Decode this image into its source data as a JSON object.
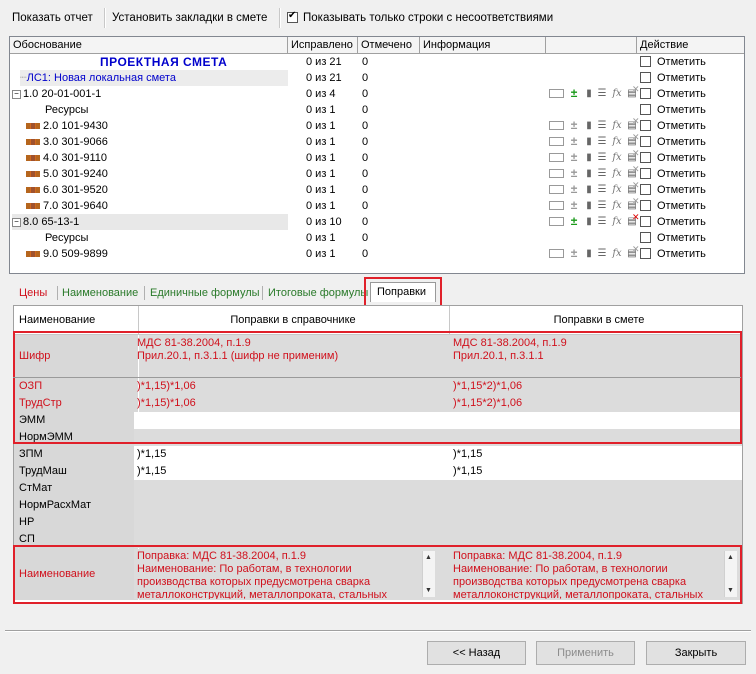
{
  "toolbar": {
    "show_report": "Показать отчет",
    "set_bookmarks": "Установить закладки в смете",
    "only_mismatch_label": "Показывать только строки с несоответствиями",
    "only_mismatch_checked": true
  },
  "tree": {
    "columns": [
      "Обоснование",
      "Исправлено",
      "Отмечено",
      "Информация",
      "",
      "Действие"
    ],
    "rows": [
      {
        "name": "ПРОЕКТНАЯ СМЕТА",
        "fixed": "0 из 21",
        "marked": "0",
        "action": "Отметить",
        "kind": "title"
      },
      {
        "name": "ЛС1: Новая локальная смета",
        "fixed": "0 из 21",
        "marked": "0",
        "action": "Отметить",
        "kind": "ls"
      },
      {
        "name": "1.0   20-01-001-1",
        "fixed": "0 из 4",
        "marked": "0",
        "action": "Отметить",
        "kind": "group",
        "icons": "active"
      },
      {
        "name": "Ресурсы",
        "fixed": "0 из 1",
        "marked": "0",
        "action": "Отметить",
        "kind": "res-label"
      },
      {
        "name": "2.0   101-9430",
        "fixed": "0 из 1",
        "marked": "0",
        "action": "Отметить",
        "kind": "item",
        "icons": "grey"
      },
      {
        "name": "3.0   301-9066",
        "fixed": "0 из 1",
        "marked": "0",
        "action": "Отметить",
        "kind": "item",
        "icons": "grey"
      },
      {
        "name": "4.0   301-9110",
        "fixed": "0 из 1",
        "marked": "0",
        "action": "Отметить",
        "kind": "item",
        "icons": "grey"
      },
      {
        "name": "5.0   301-9240",
        "fixed": "0 из 1",
        "marked": "0",
        "action": "Отметить",
        "kind": "item",
        "icons": "grey"
      },
      {
        "name": "6.0   301-9520",
        "fixed": "0 из 1",
        "marked": "0",
        "action": "Отметить",
        "kind": "item",
        "icons": "grey"
      },
      {
        "name": "7.0   301-9640",
        "fixed": "0 из 1",
        "marked": "0",
        "action": "Отметить",
        "kind": "item",
        "icons": "grey"
      },
      {
        "name": "8.0   65-13-1",
        "fixed": "0 из 10",
        "marked": "0",
        "action": "Отметить",
        "kind": "group",
        "icons": "active-red"
      },
      {
        "name": "Ресурсы",
        "fixed": "0 из 1",
        "marked": "0",
        "action": "Отметить",
        "kind": "res-label"
      },
      {
        "name": "9.0   509-9899",
        "fixed": "0 из 1",
        "marked": "0",
        "action": "Отметить",
        "kind": "item",
        "icons": "grey"
      }
    ]
  },
  "tabs": [
    "Цены",
    "Наименование",
    "Единичные формулы",
    "Итоговые формулы",
    "Поправки"
  ],
  "active_tab": "Поправки",
  "corrections": {
    "headers": [
      "Наименование",
      "Поправки в справочнике",
      "Поправки в смете"
    ],
    "shifr": {
      "name": "Шифр",
      "ref": "МДС 81-38.2004, п.1.9\nПрил.20.1, п.3.1.1 (шифр не применим)",
      "est": "МДС 81-38.2004, п.1.9\nПрил.20.1, п.3.1.1"
    },
    "rows": [
      {
        "name": "ОЗП",
        "ref": ")*1,15)*1,06",
        "est": ")*1,15*2)*1,06",
        "red": true
      },
      {
        "name": "ТрудСтр",
        "ref": ")*1,15)*1,06",
        "est": ")*1,15*2)*1,06",
        "red": true
      },
      {
        "name": "ЭММ",
        "ref": "",
        "est": "",
        "red": false
      },
      {
        "name": "НормЭММ",
        "ref": "",
        "est": "",
        "red": false
      },
      {
        "name": "ЗПМ",
        "ref": ")*1,15",
        "est": ")*1,15",
        "red": false
      },
      {
        "name": "ТрудМаш",
        "ref": ")*1,15",
        "est": ")*1,15",
        "red": false
      },
      {
        "name": "СтМат",
        "ref": "",
        "est": "",
        "red": false
      },
      {
        "name": "НормРасхМат",
        "ref": "",
        "est": "",
        "red": false
      },
      {
        "name": "НР",
        "ref": "",
        "est": "",
        "red": false
      },
      {
        "name": "СП",
        "ref": "",
        "est": "",
        "red": false
      }
    ],
    "naimenovanie": {
      "name": "Наименование",
      "ref": "Поправка: МДС 81-38.2004, п.1.9\nНаименование: По работам, в технологии производства которых предусмотрена сварка металлоконструкций, металлопроката, стальных",
      "est": "Поправка: МДС 81-38.2004, п.1.9\nНаименование: По работам, в технологии производства которых предусмотрена сварка металлоконструкций, металлопроката, стальных"
    }
  },
  "buttons": {
    "back": "<< Назад",
    "apply": "Применить",
    "close": "Закрыть"
  }
}
